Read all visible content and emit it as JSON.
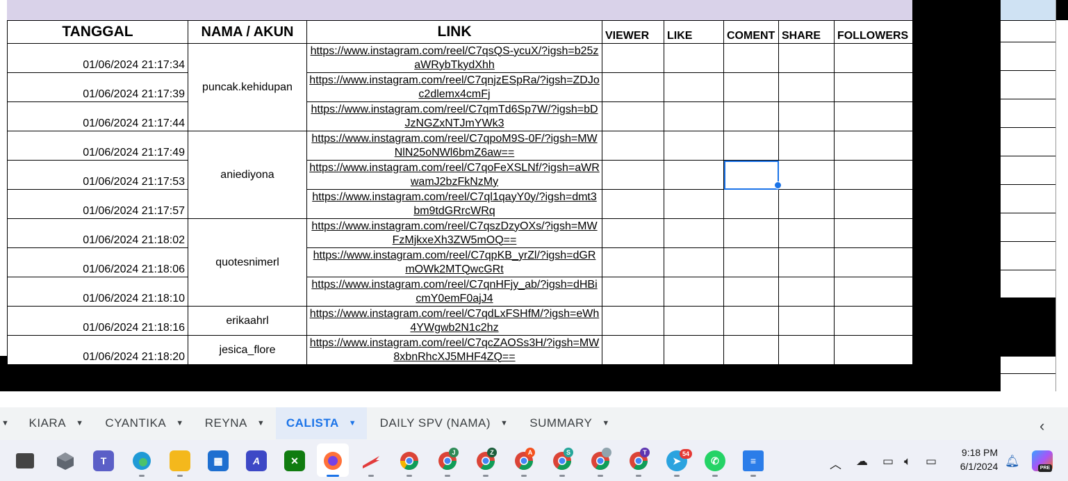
{
  "sheet": {
    "headers": {
      "tanggal": "TANGGAL",
      "nama": "NAMA / AKUN",
      "link": "LINK",
      "viewer": "VIEWER",
      "like": "LIKE",
      "coment": "COMENT",
      "share": "SHARE",
      "followers": "FOLLOWERS"
    },
    "rows": [
      {
        "date": "01/06/2024 21:17:34",
        "link": "https://www.instagram.com/reel/C7qsQS-ycuX/?igsh=b25zaWRybTkydXhh"
      },
      {
        "date": "01/06/2024 21:17:39",
        "link": "https://www.instagram.com/reel/C7qnjzESpRa/?igsh=ZDJoc2dlemx4cmFj"
      },
      {
        "date": "01/06/2024 21:17:44",
        "link": "https://www.instagram.com/reel/C7qmTd6Sp7W/?igsh=bDJzNGZxNTJmYWk3"
      },
      {
        "date": "01/06/2024 21:17:49",
        "link": "https://www.instagram.com/reel/C7qpoM9S-0F/?igsh=MWNlN25oNWl6bmZ6aw=="
      },
      {
        "date": "01/06/2024 21:17:53",
        "link": "https://www.instagram.com/reel/C7qoFeXSLNf/?igsh=aWRwamJ2bzFkNzMy"
      },
      {
        "date": "01/06/2024 21:17:57",
        "link": "https://www.instagram.com/reel/C7ql1qayY0y/?igsh=dmt3bm9tdGRrcWRq"
      },
      {
        "date": "01/06/2024 21:18:02",
        "link": "https://www.instagram.com/reel/C7qszDzyOXs/?igsh=MWFzMjkxeXh3ZW5mOQ=="
      },
      {
        "date": "01/06/2024 21:18:06",
        "link": "https://www.instagram.com/reel/C7qpKB_yrZl/?igsh=dGRmOWk2MTQwcGRt"
      },
      {
        "date": "01/06/2024 21:18:10",
        "link": "https://www.instagram.com/reel/C7qnHFjy_ab/?igsh=dHBicmY0emF0ajJ4"
      },
      {
        "date": "01/06/2024 21:18:16",
        "link": "https://www.instagram.com/reel/C7qdLxFSHfM/?igsh=eWh4YWgwb2N1c2hz"
      },
      {
        "date": "01/06/2024 21:18:20",
        "link": "https://www.instagram.com/reel/C7qcZAOSs3H/?igsh=MW8xbnRhcXJ5MHF4ZQ=="
      }
    ],
    "accounts": [
      "puncak.kehidupan",
      "aniediyona",
      "quotesnimerl",
      "erikaahrl",
      "jesica_flore"
    ]
  },
  "tabs": [
    "KIARA",
    "CYANTIKA",
    "REYNA",
    "CALISTA",
    "DAILY SPV (NAMA)",
    "SUMMARY"
  ],
  "active_tab": "CALISTA",
  "taskbar": {
    "icons": [
      "task-view-icon",
      "app-3d-icon",
      "teams-icon",
      "edge-icon",
      "file-explorer-icon",
      "store-icon",
      "app-a-icon",
      "xbox-icon",
      "firefox-icon",
      "app-wing-icon",
      "chrome-icon",
      "chrome-profile-j-icon",
      "chrome-profile-z-icon",
      "chrome-profile-a-icon",
      "chrome-profile-s-icon",
      "chrome-profile-user-icon",
      "chrome-profile-t-icon",
      "telegram-icon",
      "whatsapp-icon",
      "notepad-icon"
    ],
    "profile_badges": {
      "j": "J",
      "z": "Z",
      "a": "A",
      "s": "S",
      "t": "T"
    },
    "telegram_badge": "54",
    "time": "9:18 PM",
    "date": "6/1/2024",
    "copilot_badge": "PRE"
  },
  "colors": {
    "accent": "#1a73e8",
    "header_band": "#d9d2e9"
  }
}
